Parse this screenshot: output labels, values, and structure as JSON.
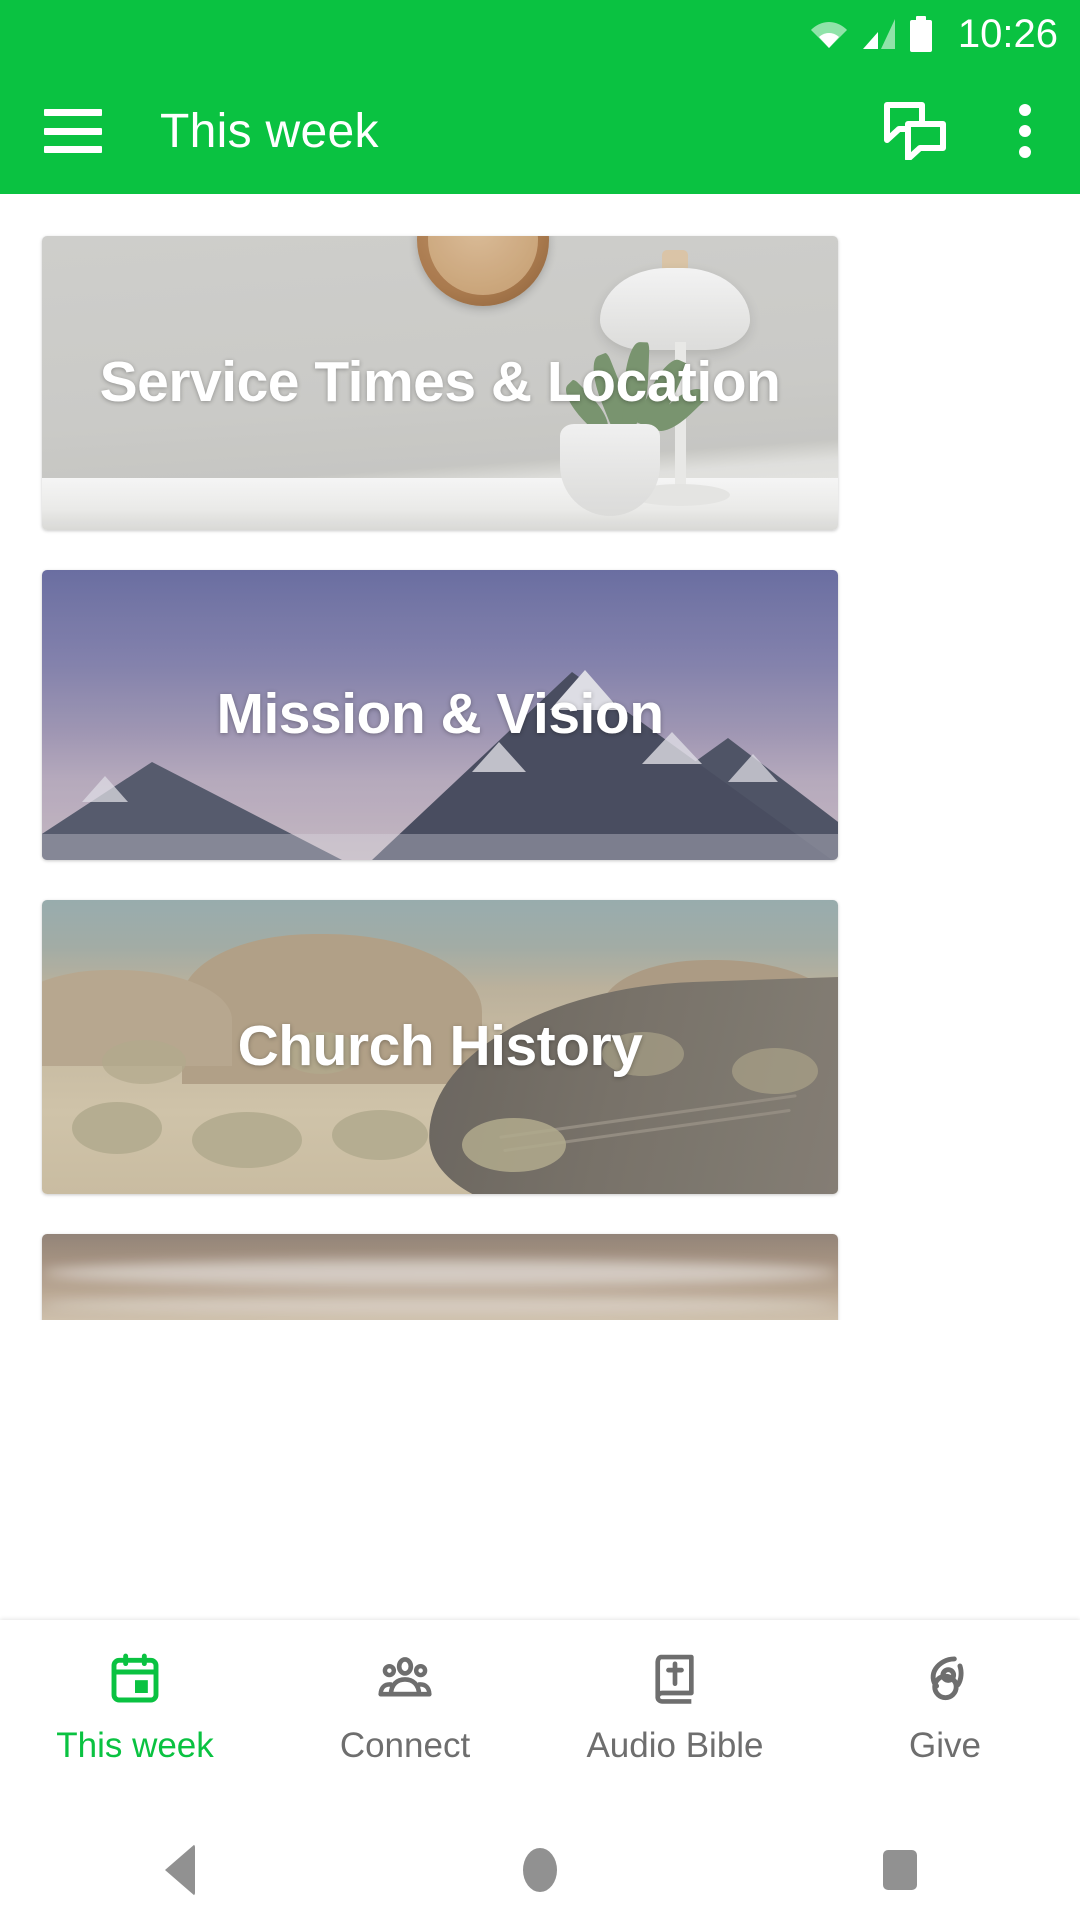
{
  "status_bar": {
    "time": "10:26",
    "icons": [
      "wifi-icon",
      "cell-signal-icon",
      "battery-icon"
    ]
  },
  "app_bar": {
    "menu_icon": "hamburger-menu-icon",
    "title": "This week",
    "chat_icon": "chat-bubbles-icon",
    "overflow_icon": "more-vert-icon",
    "background_color": "#0ac241"
  },
  "main": {
    "cards": [
      {
        "title": "Service Times & Location",
        "image": "interior-wall-clock-lamp-plant"
      },
      {
        "title": "Mission & Vision",
        "image": "snow-mountains-twilight"
      },
      {
        "title": "Church History",
        "image": "desert-road-landscape"
      },
      {
        "title": "",
        "image": "dusk-sky-over-water"
      }
    ]
  },
  "bottom_nav": {
    "active_color": "#0ac241",
    "inactive_color": "#6e6e6e",
    "items": [
      {
        "label": "This week",
        "icon": "calendar-icon",
        "active": true
      },
      {
        "label": "Connect",
        "icon": "people-group-icon",
        "active": false
      },
      {
        "label": "Audio Bible",
        "icon": "bible-book-cross-icon",
        "active": false
      },
      {
        "label": "Give",
        "icon": "giving-hand-icon",
        "active": false
      }
    ]
  },
  "system_nav": {
    "back": "back-triangle-icon",
    "home": "home-circle-icon",
    "recents": "recents-square-icon"
  }
}
